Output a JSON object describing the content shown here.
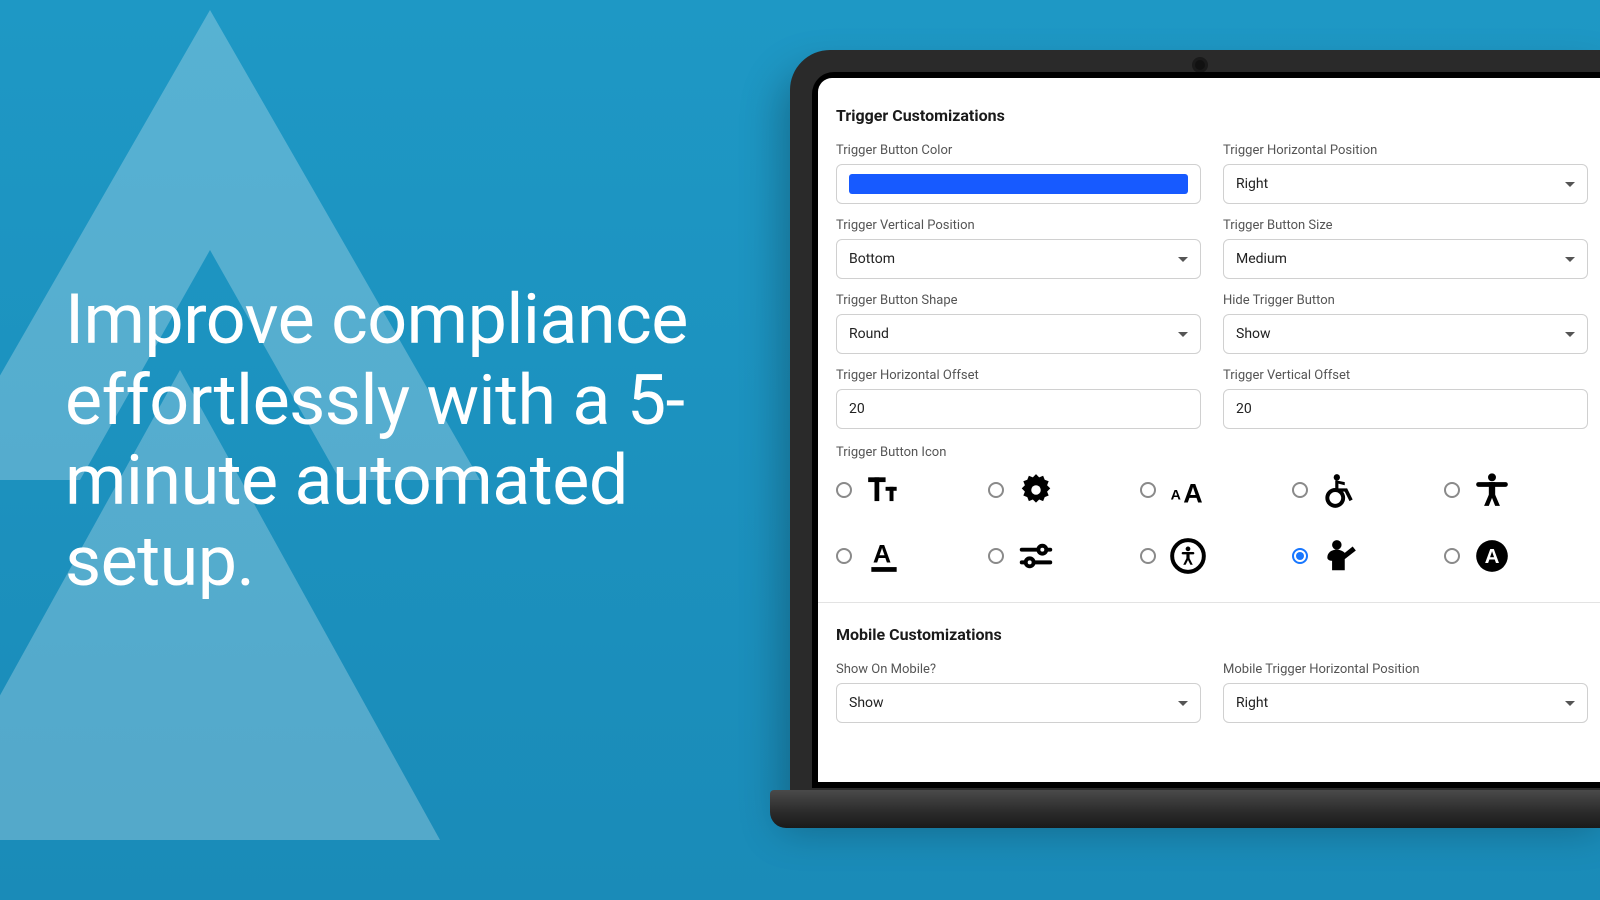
{
  "marketing": {
    "headline": "Improve compliance effortlessly with a 5-minute automated setup."
  },
  "triggerSection": {
    "title": "Trigger Customizations",
    "fields": {
      "buttonColor": {
        "label": "Trigger Button Color",
        "value": "#175aff"
      },
      "horizontalPosition": {
        "label": "Trigger Horizontal Position",
        "value": "Right"
      },
      "verticalPosition": {
        "label": "Trigger Vertical Position",
        "value": "Bottom"
      },
      "buttonSize": {
        "label": "Trigger Button Size",
        "value": "Medium"
      },
      "buttonShape": {
        "label": "Trigger Button Shape",
        "value": "Round"
      },
      "hideTrigger": {
        "label": "Hide Trigger Button",
        "value": "Show"
      },
      "horizontalOffset": {
        "label": "Trigger Horizontal Offset",
        "value": "20"
      },
      "verticalOffset": {
        "label": "Trigger Vertical Offset",
        "value": "20"
      },
      "iconLabel": "Trigger Button Icon"
    },
    "icons": [
      {
        "name": "text-size-icon",
        "selected": false
      },
      {
        "name": "gear-icon",
        "selected": false
      },
      {
        "name": "font-scale-icon",
        "selected": false
      },
      {
        "name": "wheelchair-icon",
        "selected": false
      },
      {
        "name": "accessibility-body-icon",
        "selected": false
      },
      {
        "name": "underline-a-icon",
        "selected": false
      },
      {
        "name": "sliders-icon",
        "selected": false
      },
      {
        "name": "person-circle-icon",
        "selected": false
      },
      {
        "name": "hand-raised-icon",
        "selected": true
      },
      {
        "name": "a-badge-icon",
        "selected": false
      }
    ]
  },
  "mobileSection": {
    "title": "Mobile Customizations",
    "fields": {
      "showOnMobile": {
        "label": "Show On Mobile?",
        "value": "Show"
      },
      "mobileHorizontal": {
        "label": "Mobile Trigger Horizontal Position",
        "value": "Right"
      }
    }
  }
}
